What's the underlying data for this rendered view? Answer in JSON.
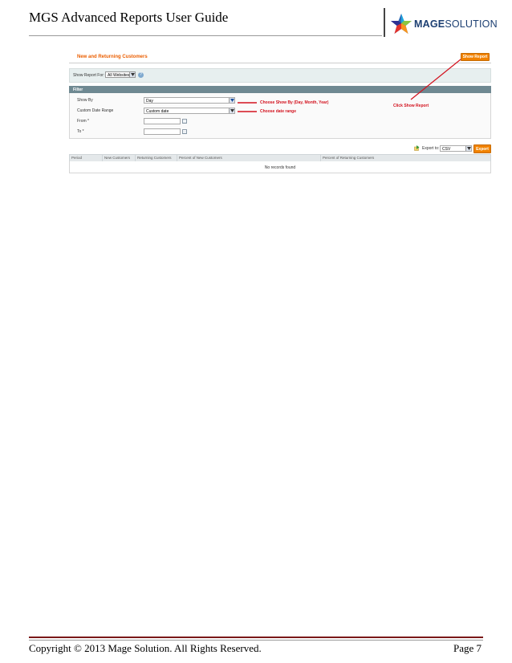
{
  "document": {
    "title": "MGS Advanced Reports User Guide",
    "logo": {
      "brand_bold": "MAGE",
      "brand_light": "SOLUTION",
      "icon": "star-logo-icon"
    },
    "footer": {
      "copyright": "Copyright © 2013 Mage Solution. All Rights Reserved.",
      "page": "Page 7"
    }
  },
  "screenshot": {
    "page_title": "New and Returning Customers",
    "show_report_button": "Show Report",
    "store_switcher": {
      "label": "Show Report For:",
      "value": "All Websites",
      "help_icon": "help-icon"
    },
    "filter": {
      "title": "Filter",
      "fields": [
        {
          "label": "Show By",
          "value": "Day"
        },
        {
          "label": "Custom Date Range",
          "value": "Custom date"
        },
        {
          "label": "From *",
          "value": ""
        },
        {
          "label": "To *",
          "value": ""
        }
      ]
    },
    "export": {
      "label": "Export to:",
      "value": "CSV",
      "button": "Export",
      "icon": "export-icon"
    },
    "grid": {
      "columns": [
        "Period",
        "New Customers",
        "Returning Customers",
        "Percent of New Customers",
        "Percent of Returning Customers"
      ],
      "empty_message": "No records found"
    }
  },
  "annotations": {
    "show_by": "Choose Show By (Day, Month, Year)",
    "date_range": "Choose date range",
    "show_report": "Click Show Report",
    "color": "#d3121e"
  },
  "colors": {
    "accent_orange": "#f18200",
    "title_orange": "#eb5e00",
    "filter_header": "#6f8992",
    "footer_rule": "#7a1818",
    "logo_blue": "#1c3f72"
  }
}
